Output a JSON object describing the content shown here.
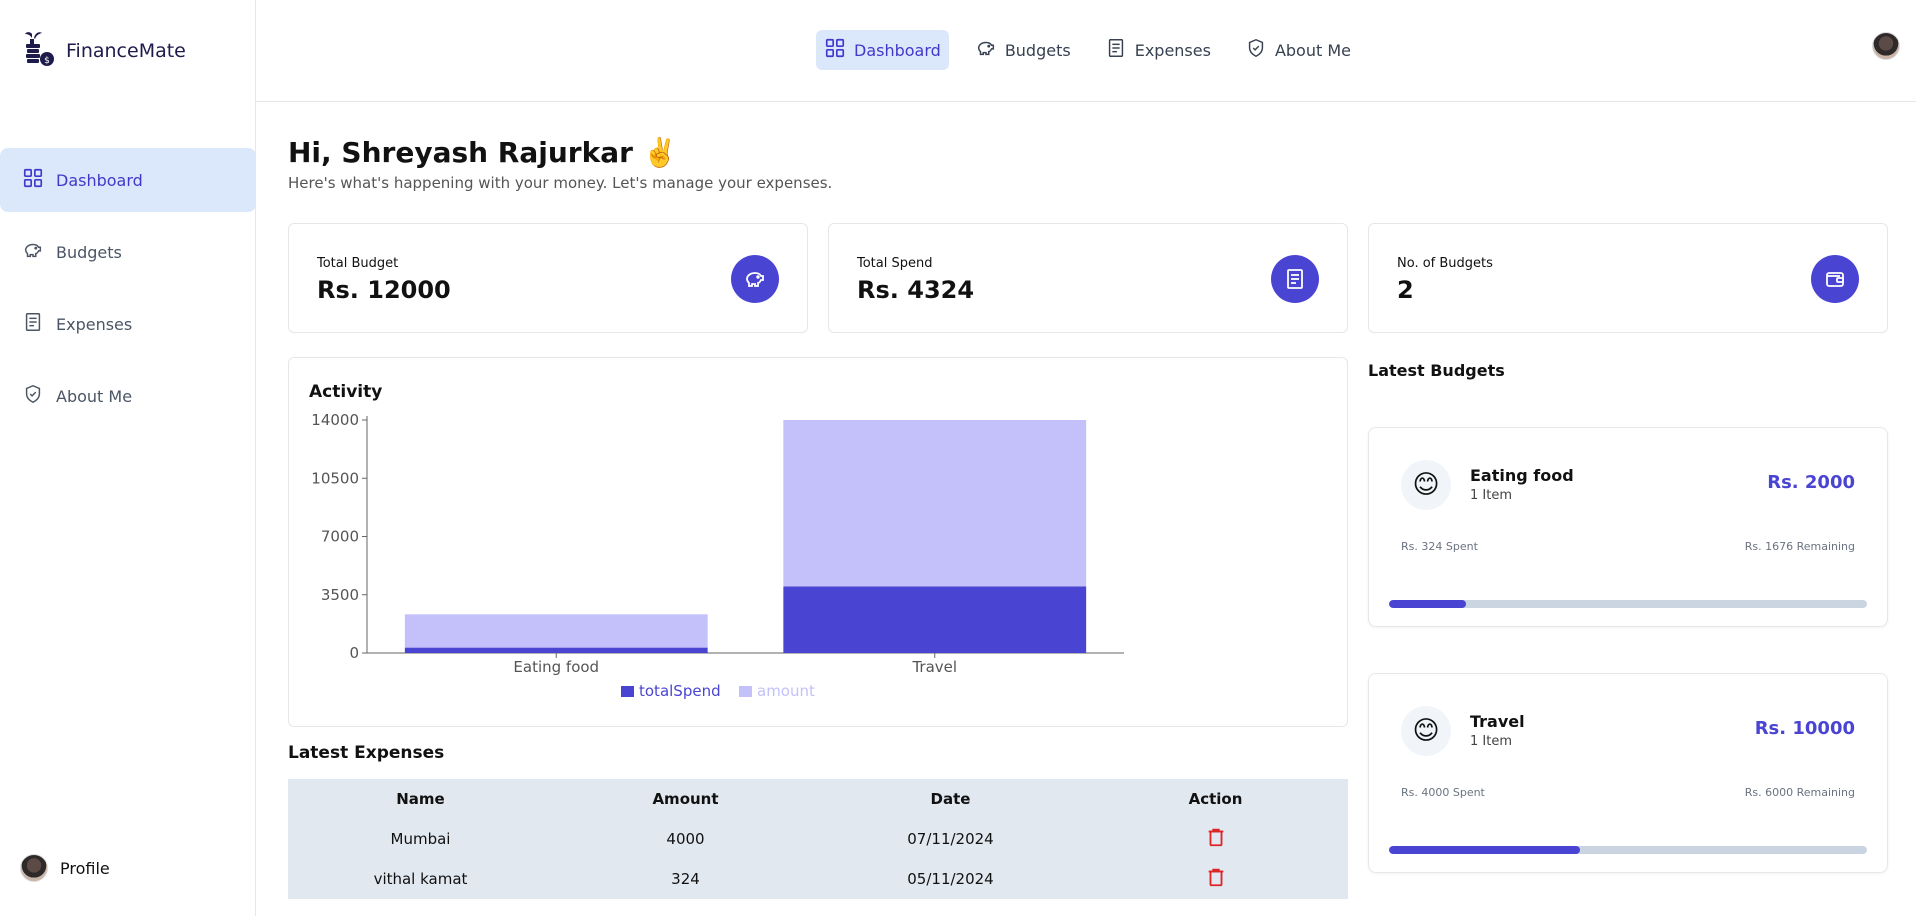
{
  "app": {
    "name": "FinanceMate"
  },
  "sidebar": {
    "items": [
      {
        "label": "Dashboard",
        "icon": "grid-icon",
        "active": true
      },
      {
        "label": "Budgets",
        "icon": "piggy-bank-icon",
        "active": false
      },
      {
        "label": "Expenses",
        "icon": "receipt-icon",
        "active": false
      },
      {
        "label": "About Me",
        "icon": "shield-check-icon",
        "active": false
      }
    ],
    "profile_label": "Profile"
  },
  "topnav": {
    "items": [
      {
        "label": "Dashboard",
        "icon": "grid-icon",
        "active": true
      },
      {
        "label": "Budgets",
        "icon": "piggy-bank-icon",
        "active": false
      },
      {
        "label": "Expenses",
        "icon": "receipt-icon",
        "active": false
      },
      {
        "label": "About Me",
        "icon": "shield-check-icon",
        "active": false
      }
    ]
  },
  "header": {
    "greeting": "Hi, Shreyash Rajurkar ✌️",
    "subtitle": "Here's what's happening with your money. Let's manage your expenses."
  },
  "cards": [
    {
      "label": "Total Budget",
      "value": "Rs. 12000",
      "icon": "piggy-bank-icon"
    },
    {
      "label": "Total Spend",
      "value": "Rs. 4324",
      "icon": "receipt-icon"
    },
    {
      "label": "No. of Budgets",
      "value": "2",
      "icon": "wallet-icon"
    }
  ],
  "chart": {
    "title": "Activity"
  },
  "chart_data": {
    "type": "bar",
    "stacked": true,
    "categories": [
      "Eating food",
      "Travel"
    ],
    "series": [
      {
        "name": "totalSpend",
        "values": [
          324,
          4000
        ],
        "color": "#4a44d3"
      },
      {
        "name": "amount",
        "values": [
          2000,
          10000
        ],
        "color": "#c3c0fa"
      }
    ],
    "y_ticks": [
      0,
      3500,
      7000,
      10500,
      14000
    ],
    "ylim": [
      0,
      14000
    ],
    "legend": "bottom"
  },
  "expenses": {
    "title": "Latest Expenses",
    "columns": [
      "Name",
      "Amount",
      "Date",
      "Action"
    ],
    "rows": [
      {
        "name": "Mumbai",
        "amount": "4000",
        "date": "07/11/2024"
      },
      {
        "name": "vithal kamat",
        "amount": "324",
        "date": "05/11/2024"
      }
    ]
  },
  "budgets": {
    "title": "Latest Budgets",
    "items": [
      {
        "emoji": "😊",
        "name": "Eating food",
        "items": "1 Item",
        "amount": "Rs. 2000",
        "spent": "Rs. 324 Spent",
        "remaining": "Rs. 1676 Remaining",
        "progress": 0.162
      },
      {
        "emoji": "😊",
        "name": "Travel",
        "items": "1 Item",
        "amount": "Rs. 10000",
        "spent": "Rs. 4000 Spent",
        "remaining": "Rs. 6000 Remaining",
        "progress": 0.4
      }
    ]
  },
  "colors": {
    "accent": "#4a44d3",
    "accent_light": "#c3c0fa",
    "nav_active_bg": "#dbe7fb",
    "table_bg": "#e2e8f0",
    "danger": "#dc2626"
  }
}
